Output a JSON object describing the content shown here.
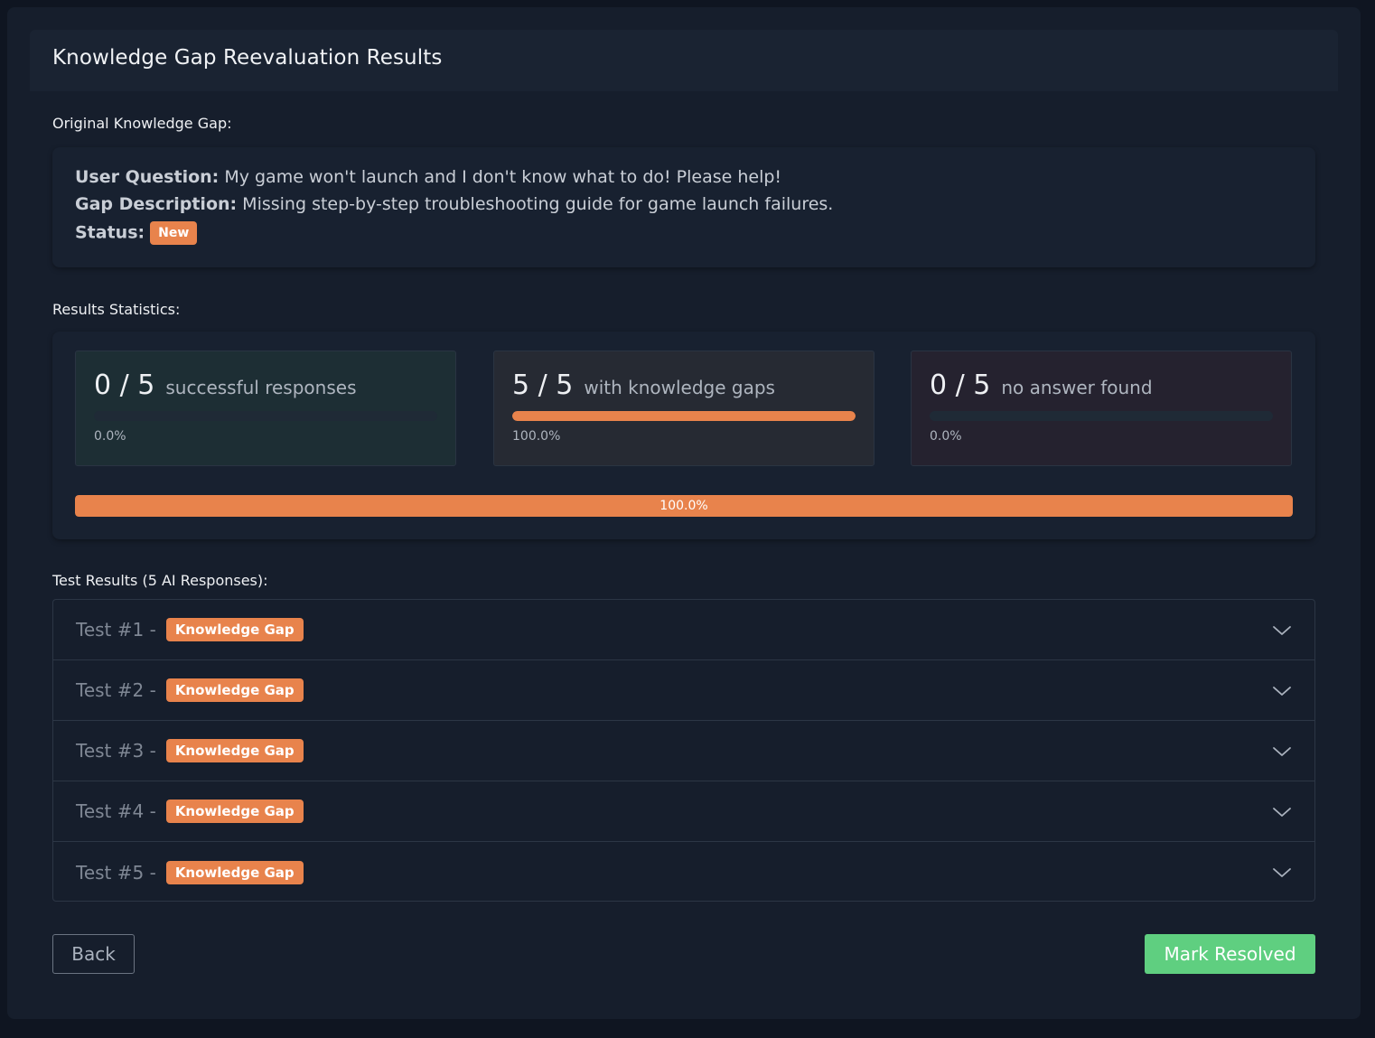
{
  "panel": {
    "title": "Knowledge Gap Reevaluation Results"
  },
  "original_gap": {
    "section_label": "Original Knowledge Gap:",
    "user_question_label": "User Question:",
    "user_question": "My game won't launch and I don't know what to do! Please help!",
    "gap_description_label": "Gap Description:",
    "gap_description": "Missing step-by-step troubleshooting guide for game launch failures.",
    "status_label": "Status:",
    "status": "New"
  },
  "statistics": {
    "section_label": "Results Statistics:",
    "cards": [
      {
        "count": "0 / 5",
        "description": "successful responses",
        "percent_text": "0.0%",
        "fraction": 0.0
      },
      {
        "count": "5 / 5",
        "description": "with knowledge gaps",
        "percent_text": "100.0%",
        "fraction": 1.0
      },
      {
        "count": "0 / 5",
        "description": "no answer found",
        "percent_text": "0.0%",
        "fraction": 0.0
      }
    ],
    "overall": {
      "percent_text": "100.0%",
      "fraction": 1.0
    }
  },
  "tests": {
    "section_label": "Test Results (5 AI Responses):",
    "items": [
      {
        "label": "Test #1 -",
        "badge": "Knowledge Gap"
      },
      {
        "label": "Test #2 -",
        "badge": "Knowledge Gap"
      },
      {
        "label": "Test #3 -",
        "badge": "Knowledge Gap"
      },
      {
        "label": "Test #4 -",
        "badge": "Knowledge Gap"
      },
      {
        "label": "Test #5 -",
        "badge": "Knowledge Gap"
      }
    ]
  },
  "actions": {
    "back_label": "Back",
    "resolve_label": "Mark Resolved"
  },
  "colors": {
    "accent_orange": "#e8834c",
    "success_green": "#5fcf80",
    "background": "#0f1521",
    "panel": "#161e2c"
  },
  "icons": {
    "accordion_toggle": "chevron-down-icon"
  }
}
